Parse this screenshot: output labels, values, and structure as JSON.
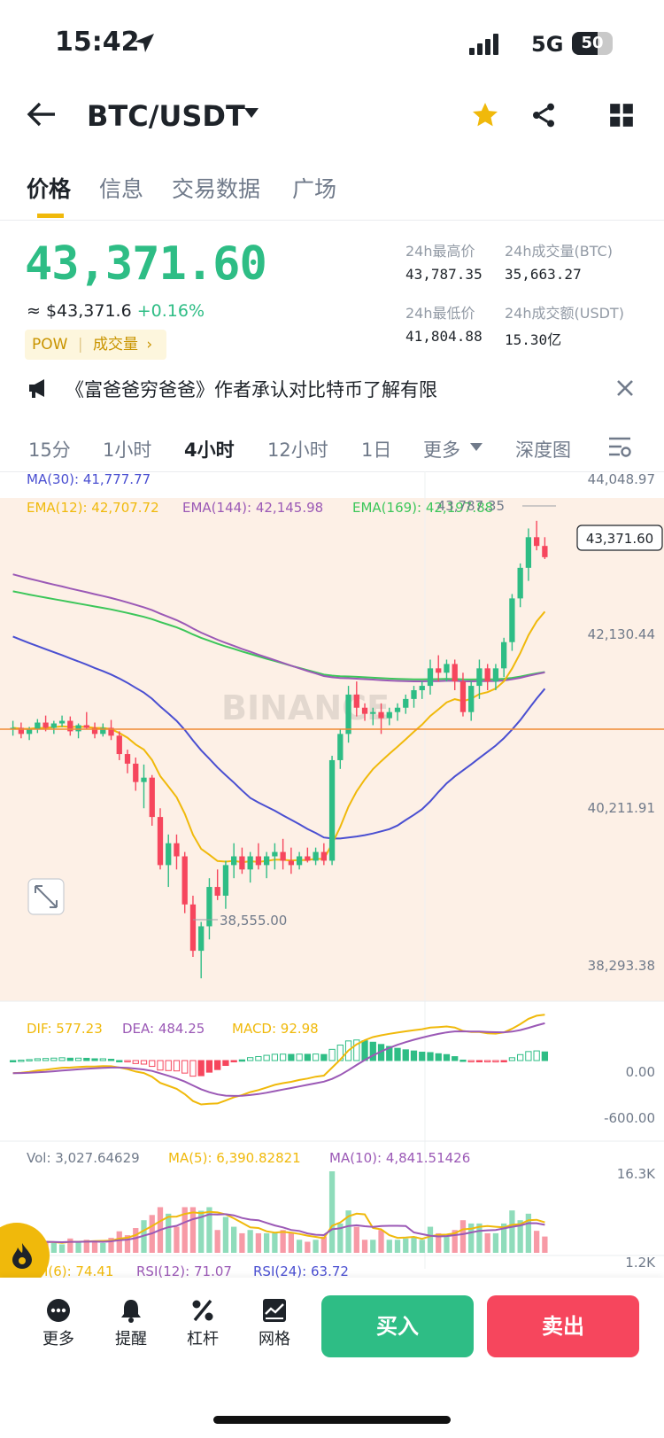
{
  "status_bar": {
    "time": "15:42",
    "network": "5G",
    "battery": "50"
  },
  "header": {
    "title": "BTC/USDT"
  },
  "tabs": [
    {
      "label": "价格",
      "active": true
    },
    {
      "label": "信息"
    },
    {
      "label": "交易数据"
    },
    {
      "label": "广场"
    }
  ],
  "ticker": {
    "price": "43,371.60",
    "usd_approx": "≈ $43,371.6",
    "change": "+0.16%",
    "tag": "POW",
    "tag_link": "成交量",
    "stats": [
      {
        "label": "24h最高价",
        "value": "43,787.35"
      },
      {
        "label": "24h成交量(BTC)",
        "value": "35,663.27"
      },
      {
        "label": "24h最低价",
        "value": "41,804.88"
      },
      {
        "label": "24h成交额(USDT)",
        "value": "15.30亿"
      }
    ]
  },
  "news": {
    "text": "《富爸爸穷爸爸》作者承认对比特币了解有限"
  },
  "timeframes": [
    {
      "label": "15分"
    },
    {
      "label": "1小时"
    },
    {
      "label": "4小时",
      "active": true
    },
    {
      "label": "12小时"
    },
    {
      "label": "1日"
    },
    {
      "label": "更多"
    },
    {
      "label": "深度图"
    }
  ],
  "indicators": {
    "ma30": "MA(30): 41,777.77",
    "ema12": "EMA(12): 42,707.72",
    "ema144": "EMA(144): 42,145.98",
    "ema169": "EMA(169): 42,197.88",
    "high_mark": "43,787.35",
    "low_mark": "38,555.00",
    "current_price_tag": "43,371.60",
    "watermark": "BINANCE",
    "axis": [
      "44,048.97",
      "42,130.44",
      "40,211.91",
      "38,293.38"
    ],
    "macd_labels": {
      "dif": "DIF: 577.23",
      "dea": "DEA: 484.25",
      "macd": "MACD: 92.98"
    },
    "macd_axis": [
      "0.00",
      "-600.00"
    ],
    "vol_labels": {
      "vol": "Vol: 3,027.64629",
      "ma5": "MA(5): 6,390.82821",
      "ma10": "MA(10): 4,841.51426"
    },
    "vol_axis": [
      "16.3K",
      "1.2K"
    ],
    "rsi_labels": {
      "rsi6": "RSI(6): 74.41",
      "rsi12": "RSI(12): 71.07",
      "rsi24": "RSI(24): 63.72"
    }
  },
  "colors": {
    "up": "#2ebd85",
    "down": "#f6465d",
    "accent": "#f0b90b",
    "ma30": "#4a4fd1",
    "ema12": "#f0b90b",
    "ema144": "#9b59b6",
    "ema169": "#3cc65a"
  },
  "chart_data": {
    "type": "candlestick",
    "ylim": [
      38293.38,
      44048.97
    ],
    "ohlc": [
      [
        41400,
        41500,
        41330,
        41420
      ],
      [
        41420,
        41480,
        41300,
        41350
      ],
      [
        41350,
        41430,
        41280,
        41400
      ],
      [
        41400,
        41520,
        41360,
        41480
      ],
      [
        41480,
        41560,
        41380,
        41420
      ],
      [
        41420,
        41500,
        41350,
        41470
      ],
      [
        41470,
        41560,
        41430,
        41500
      ],
      [
        41500,
        41550,
        41330,
        41380
      ],
      [
        41380,
        41470,
        41300,
        41450
      ],
      [
        41450,
        41600,
        41400,
        41420
      ],
      [
        41420,
        41480,
        41300,
        41350
      ],
      [
        41350,
        41470,
        41320,
        41420
      ],
      [
        41420,
        41510,
        41280,
        41330
      ],
      [
        41330,
        41380,
        41050,
        41120
      ],
      [
        41120,
        41170,
        40900,
        41010
      ],
      [
        41010,
        41080,
        40700,
        40800
      ],
      [
        40800,
        41000,
        40500,
        40850
      ],
      [
        40850,
        40880,
        40300,
        40400
      ],
      [
        40400,
        40500,
        39800,
        39850
      ],
      [
        39850,
        40200,
        39600,
        40100
      ],
      [
        40100,
        40200,
        39800,
        39950
      ],
      [
        39950,
        40000,
        39300,
        39400
      ],
      [
        39400,
        39500,
        38800,
        38870
      ],
      [
        38870,
        39200,
        38555,
        39150
      ],
      [
        39150,
        39700,
        39000,
        39600
      ],
      [
        39600,
        39800,
        39450,
        39500
      ],
      [
        39500,
        39900,
        39350,
        39850
      ],
      [
        39850,
        40100,
        39700,
        39950
      ],
      [
        39950,
        40050,
        39750,
        39800
      ],
      [
        39800,
        40000,
        39650,
        39950
      ],
      [
        39950,
        40100,
        39800,
        39850
      ],
      [
        39850,
        40000,
        39700,
        39950
      ],
      [
        39950,
        40100,
        39800,
        40000
      ],
      [
        40000,
        40150,
        39800,
        39900
      ],
      [
        39900,
        40050,
        39750,
        39850
      ],
      [
        39850,
        40000,
        39800,
        39950
      ],
      [
        39950,
        40050,
        39880,
        39900
      ],
      [
        39900,
        40050,
        39850,
        40000
      ],
      [
        40000,
        40100,
        39850,
        39900
      ],
      [
        39900,
        41100,
        39850,
        41050
      ],
      [
        41050,
        41400,
        40950,
        41350
      ],
      [
        41350,
        41900,
        41250,
        41800
      ],
      [
        41800,
        41950,
        41550,
        41650
      ],
      [
        41650,
        41700,
        41500,
        41580
      ],
      [
        41580,
        41650,
        41450,
        41600
      ],
      [
        41600,
        41700,
        41350,
        41530
      ],
      [
        41530,
        41650,
        41450,
        41600
      ],
      [
        41600,
        41700,
        41500,
        41650
      ],
      [
        41650,
        41800,
        41580,
        41750
      ],
      [
        41750,
        41900,
        41650,
        41850
      ],
      [
        41850,
        41950,
        41750,
        41900
      ],
      [
        41900,
        42200,
        41800,
        42100
      ],
      [
        42100,
        42250,
        41950,
        42050
      ],
      [
        42050,
        42200,
        41950,
        42150
      ],
      [
        42150,
        42200,
        41850,
        41950
      ],
      [
        41950,
        42050,
        41550,
        41600
      ],
      [
        41600,
        41950,
        41500,
        41900
      ],
      [
        41900,
        42200,
        41750,
        42100
      ],
      [
        42100,
        42150,
        41850,
        41950
      ],
      [
        41950,
        42150,
        41850,
        42100
      ],
      [
        42100,
        42450,
        42000,
        42400
      ],
      [
        42400,
        42950,
        42300,
        42900
      ],
      [
        42900,
        43300,
        42800,
        43250
      ],
      [
        43250,
        43700,
        43100,
        43600
      ],
      [
        43600,
        43787.35,
        43450,
        43500
      ],
      [
        43500,
        43600,
        43350,
        43371.6
      ]
    ]
  }
}
